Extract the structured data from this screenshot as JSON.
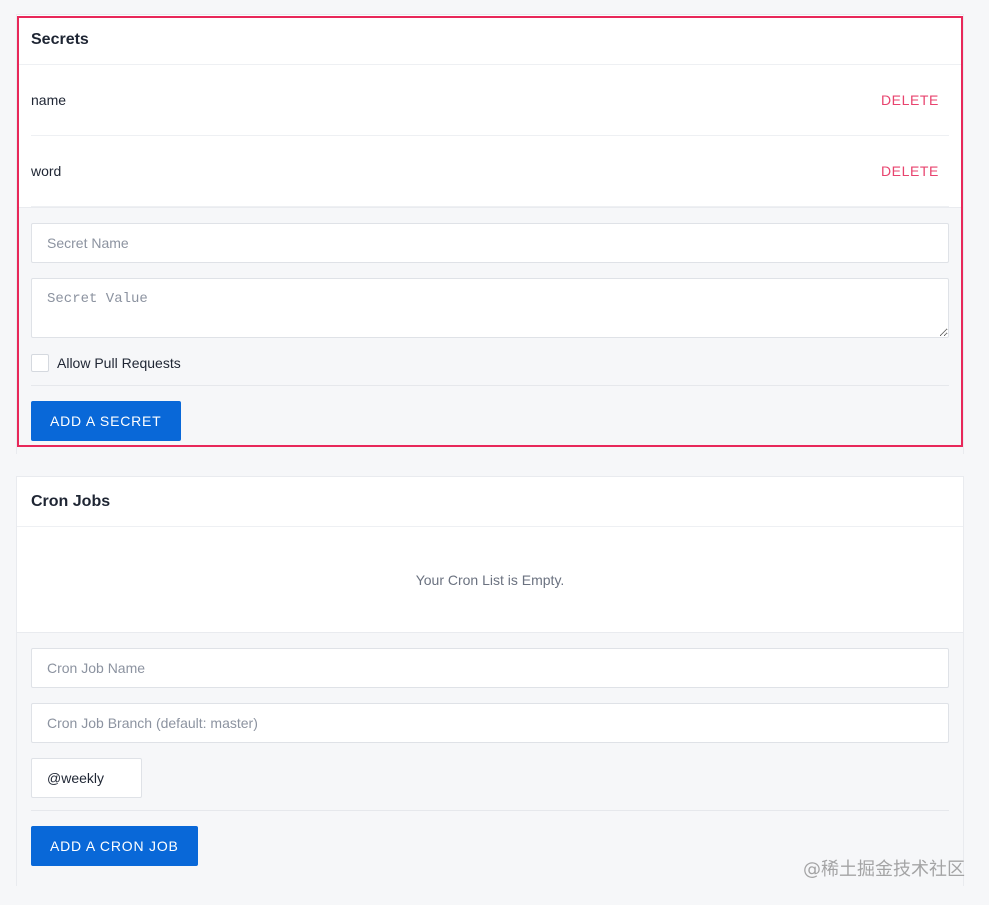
{
  "secrets": {
    "title": "Secrets",
    "items": [
      {
        "name": "name",
        "delete_label": "DELETE"
      },
      {
        "name": "word",
        "delete_label": "DELETE"
      }
    ],
    "form": {
      "name_placeholder": "Secret Name",
      "value_placeholder": "Secret Value",
      "allow_pr_label": "Allow Pull Requests",
      "allow_pr_checked": false,
      "submit_label": "ADD A SECRET"
    }
  },
  "cron": {
    "title": "Cron Jobs",
    "empty_message": "Your Cron List is Empty.",
    "form": {
      "name_placeholder": "Cron Job Name",
      "branch_placeholder": "Cron Job Branch (default: master)",
      "schedule_value": "@weekly",
      "submit_label": "ADD A CRON JOB"
    }
  },
  "watermark": "@稀土掘金技术社区",
  "colors": {
    "primary": "#0968d8",
    "danger": "#e8436e",
    "highlight": "#e8285a"
  }
}
